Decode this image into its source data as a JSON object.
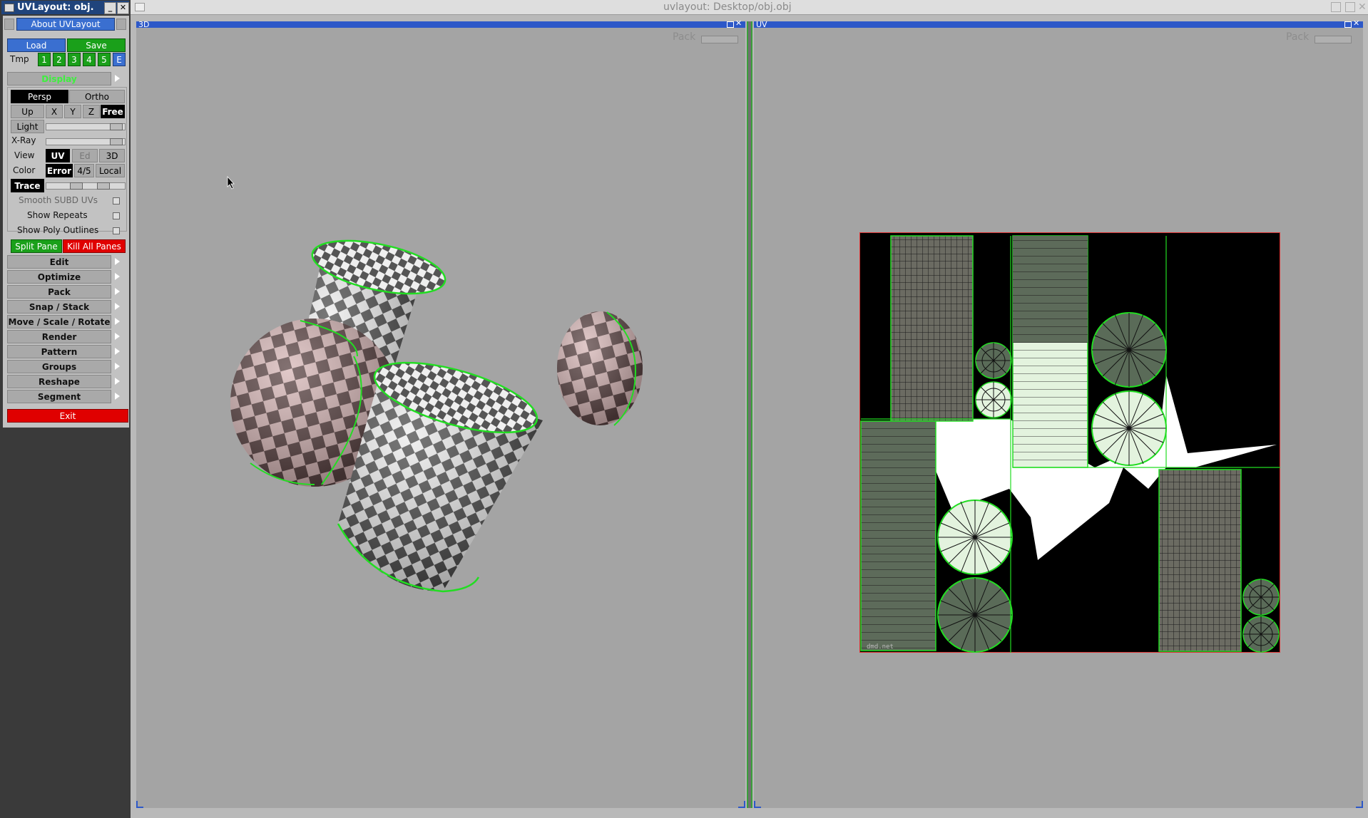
{
  "tool_window": {
    "title": "UVLayout: obj.",
    "about": "About UVLayout",
    "load": "Load",
    "save": "Save",
    "tmp_label": "Tmp",
    "tmp_slots": [
      "1",
      "2",
      "3",
      "4",
      "5",
      "E"
    ],
    "display_label": "Display",
    "persp": "Persp",
    "ortho": "Ortho",
    "up_label": "Up",
    "axes": [
      "X",
      "Y",
      "Z"
    ],
    "free": "Free",
    "light": "Light",
    "xray": "X-Ray",
    "view_label": "View",
    "view_uv": "UV",
    "view_ed": "Ed",
    "view_3d": "3D",
    "color_label": "Color",
    "color_error": "Error",
    "color_45": "4/5",
    "color_local": "Local",
    "trace": "Trace",
    "smooth_subd": "Smooth SUBD UVs",
    "show_repeats": "Show Repeats",
    "show_poly_outlines": "Show Poly Outlines",
    "split_pane": "Split Pane",
    "kill_all_panes": "Kill All Panes",
    "menus": [
      "Edit",
      "Optimize",
      "Pack",
      "Snap / Stack",
      "Move / Scale / Rotate",
      "Render",
      "Pattern",
      "Groups",
      "Reshape",
      "Segment"
    ],
    "exit": "Exit"
  },
  "main_window": {
    "title": "uvlayout: Desktop/obj.obj"
  },
  "pane_3d": {
    "label": "3D",
    "pack": "Pack"
  },
  "pane_uv": {
    "label": "UV",
    "pack": "Pack",
    "watermark": "dmd.net"
  },
  "colors": {
    "seam": "#22dd22",
    "bar": "#2d58c8",
    "exit": "#e00000"
  }
}
